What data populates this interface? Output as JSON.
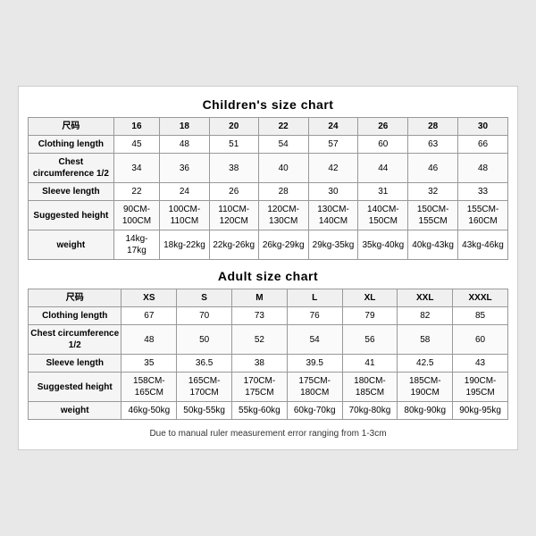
{
  "children_title": "Children's size chart",
  "adult_title": "Adult size chart",
  "footer_note": "Due to manual ruler measurement error ranging from 1-3cm",
  "children": {
    "headers": [
      "尺码",
      "16",
      "18",
      "20",
      "22",
      "24",
      "26",
      "28",
      "30"
    ],
    "rows": [
      {
        "label": "Clothing length",
        "values": [
          "45",
          "48",
          "51",
          "54",
          "57",
          "60",
          "63",
          "66"
        ]
      },
      {
        "label": "Chest circumference 1/2",
        "values": [
          "34",
          "36",
          "38",
          "40",
          "42",
          "44",
          "46",
          "48"
        ]
      },
      {
        "label": "Sleeve length",
        "values": [
          "22",
          "24",
          "26",
          "28",
          "30",
          "31",
          "32",
          "33"
        ]
      },
      {
        "label": "Suggested height",
        "values": [
          "90CM-100CM",
          "100CM-110CM",
          "110CM-120CM",
          "120CM-130CM",
          "130CM-140CM",
          "140CM-150CM",
          "150CM-155CM",
          "155CM-160CM"
        ]
      },
      {
        "label": "weight",
        "values": [
          "14kg-17kg",
          "18kg-22kg",
          "22kg-26kg",
          "26kg-29kg",
          "29kg-35kg",
          "35kg-40kg",
          "40kg-43kg",
          "43kg-46kg"
        ]
      }
    ]
  },
  "adult": {
    "headers": [
      "尺码",
      "XS",
      "S",
      "M",
      "L",
      "XL",
      "XXL",
      "XXXL"
    ],
    "rows": [
      {
        "label": "Clothing length",
        "values": [
          "67",
          "70",
          "73",
          "76",
          "79",
          "82",
          "85"
        ]
      },
      {
        "label": "Chest circumference 1/2",
        "values": [
          "48",
          "50",
          "52",
          "54",
          "56",
          "58",
          "60"
        ]
      },
      {
        "label": "Sleeve length",
        "values": [
          "35",
          "36.5",
          "38",
          "39.5",
          "41",
          "42.5",
          "43"
        ]
      },
      {
        "label": "Suggested height",
        "values": [
          "158CM-165CM",
          "165CM-170CM",
          "170CM-175CM",
          "175CM-180CM",
          "180CM-185CM",
          "185CM-190CM",
          "190CM-195CM"
        ]
      },
      {
        "label": "weight",
        "values": [
          "46kg-50kg",
          "50kg-55kg",
          "55kg-60kg",
          "60kg-70kg",
          "70kg-80kg",
          "80kg-90kg",
          "90kg-95kg"
        ]
      }
    ]
  }
}
